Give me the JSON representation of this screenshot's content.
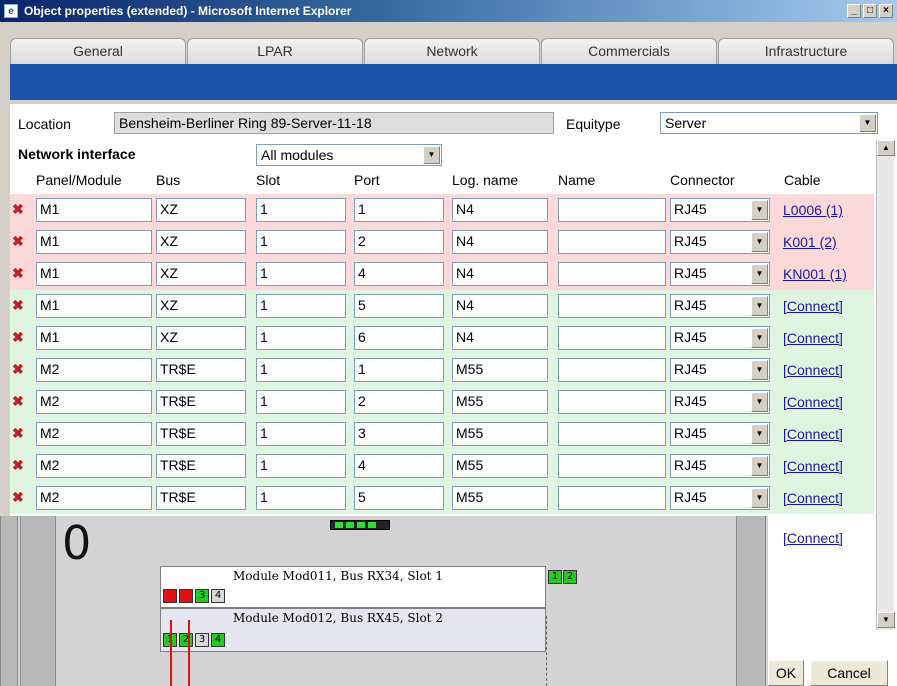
{
  "window": {
    "title": "Object properties (extended) - Microsoft Internet Explorer"
  },
  "tabs": [
    "General",
    "LPAR",
    "Network",
    "Commercials",
    "Infrastructure"
  ],
  "location": {
    "label": "Location",
    "value": "Bensheim-Berliner Ring 89-Server-11-18"
  },
  "equitype": {
    "label": "Equitype",
    "value": "Server"
  },
  "network": {
    "title": "Network interface",
    "filter": "All modules"
  },
  "columns": [
    "Panel/Module",
    "Bus",
    "Slot",
    "Port",
    "Log. name",
    "Name",
    "Connector",
    "Cable"
  ],
  "rows": [
    {
      "module": "M1",
      "bus": "XZ",
      "slot": "1",
      "port": "1",
      "log_name": "N4",
      "name": "",
      "connector": "RJ45",
      "cable": "L0006 (1)",
      "state": "red"
    },
    {
      "module": "M1",
      "bus": "XZ",
      "slot": "1",
      "port": "2",
      "log_name": "N4",
      "name": "",
      "connector": "RJ45",
      "cable": "K001 (2)",
      "state": "red"
    },
    {
      "module": "M1",
      "bus": "XZ",
      "slot": "1",
      "port": "4",
      "log_name": "N4",
      "name": "",
      "connector": "RJ45",
      "cable": "KN001 (1)",
      "state": "red"
    },
    {
      "module": "M1",
      "bus": "XZ",
      "slot": "1",
      "port": "5",
      "log_name": "N4",
      "name": "",
      "connector": "RJ45",
      "cable": "[Connect]",
      "state": "green"
    },
    {
      "module": "M1",
      "bus": "XZ",
      "slot": "1",
      "port": "6",
      "log_name": "N4",
      "name": "",
      "connector": "RJ45",
      "cable": "[Connect]",
      "state": "green"
    },
    {
      "module": "M2",
      "bus": "TR$E",
      "slot": "1",
      "port": "1",
      "log_name": "M55",
      "name": "",
      "connector": "RJ45",
      "cable": "[Connect]",
      "state": "green"
    },
    {
      "module": "M2",
      "bus": "TR$E",
      "slot": "1",
      "port": "2",
      "log_name": "M55",
      "name": "",
      "connector": "RJ45",
      "cable": "[Connect]",
      "state": "green"
    },
    {
      "module": "M2",
      "bus": "TR$E",
      "slot": "1",
      "port": "3",
      "log_name": "M55",
      "name": "",
      "connector": "RJ45",
      "cable": "[Connect]",
      "state": "green"
    },
    {
      "module": "M2",
      "bus": "TR$E",
      "slot": "1",
      "port": "4",
      "log_name": "M55",
      "name": "",
      "connector": "RJ45",
      "cable": "[Connect]",
      "state": "green"
    },
    {
      "module": "M2",
      "bus": "TR$E",
      "slot": "1",
      "port": "5",
      "log_name": "M55",
      "name": "",
      "connector": "RJ45",
      "cable": "[Connect]",
      "state": "green"
    }
  ],
  "extra_cable": "[Connect]",
  "buttons": {
    "ok": "OK",
    "cancel": "Cancel"
  },
  "diagram": {
    "rack_number": "0",
    "module1": "Module Mod011, Bus RX34, Slot 1",
    "module2": "Module Mod012, Bus RX45, Slot 2",
    "module1_ports": [
      "1",
      "2",
      "3",
      "4"
    ],
    "module2_ports": [
      "1",
      "2",
      "3",
      "4"
    ],
    "right_ports": [
      "1",
      "2"
    ]
  },
  "colors": {
    "red_row": "#fbd9d9",
    "green_row": "#dff5df",
    "link": "#1a1aa0"
  }
}
